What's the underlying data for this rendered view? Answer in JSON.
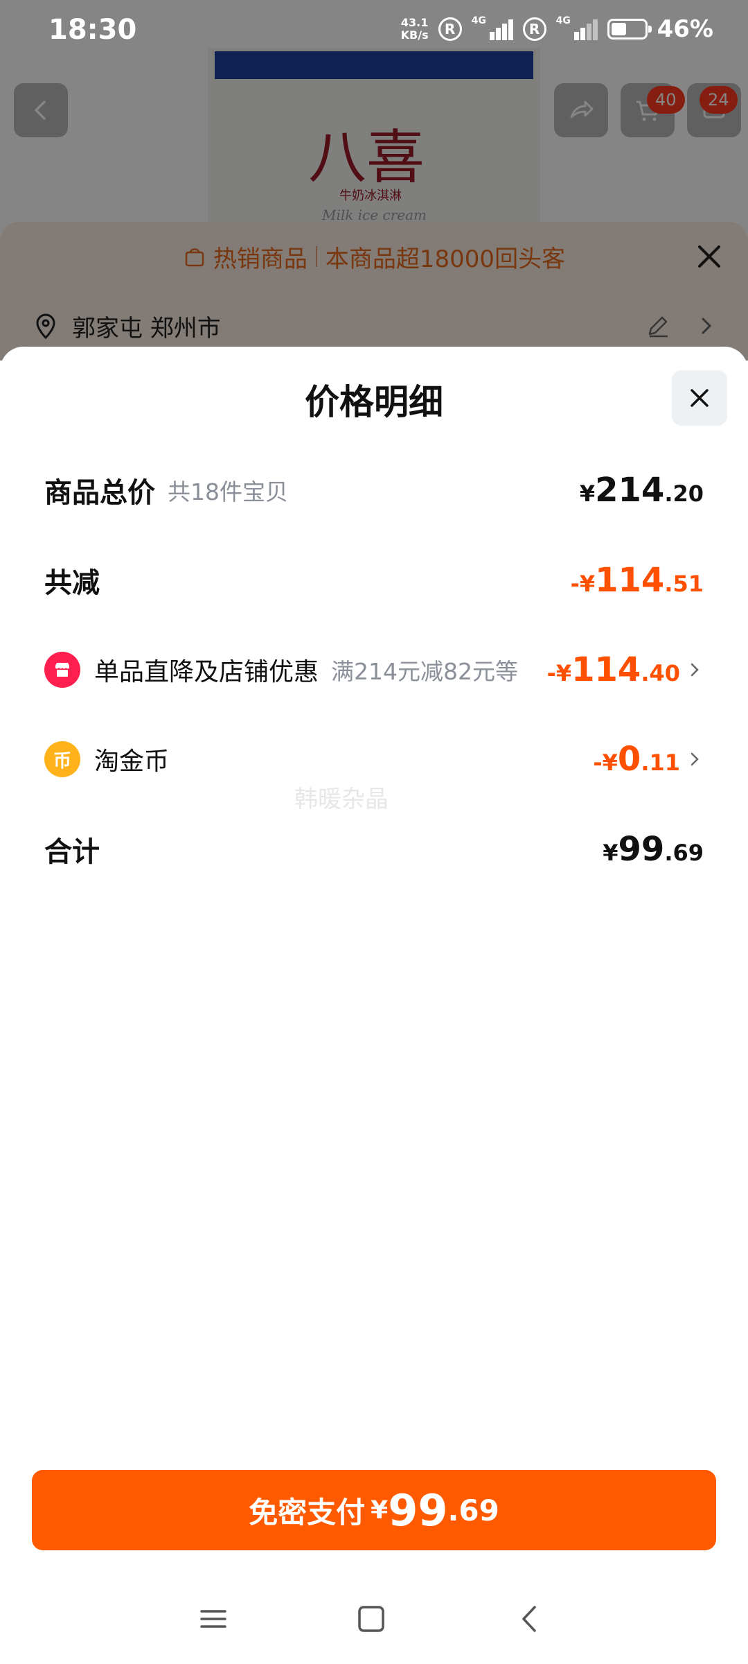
{
  "status_bar": {
    "time": "18:30",
    "net_speed_value": "43.1",
    "net_speed_unit": "KB/s",
    "sim1_label": "4G",
    "sim2_label": "4G",
    "battery_percent": "46%",
    "battery_level": 0.46
  },
  "background": {
    "brand_logo": "八喜",
    "brand_sub": "牛奶冰淇淋",
    "brand_en": "Milk ice cream",
    "cart_badge": "40",
    "msg_badge": "24",
    "hot_tag": "热销商品",
    "hot_text": "本商品超18000回头客",
    "address": "郭家屯 郑州市"
  },
  "sheet": {
    "title": "价格明细",
    "rows": {
      "total": {
        "label": "商品总价",
        "sub": "共18件宝贝",
        "currency": "¥",
        "amount_int": "214",
        "amount_dec": ".20"
      },
      "reduce": {
        "label": "共减",
        "prefix": "-¥",
        "amount_int": "114",
        "amount_dec": ".51"
      },
      "shop_discount": {
        "label": "单品直降及店铺优惠",
        "sub": "满214元减82元等",
        "prefix": "-¥",
        "amount_int": "114",
        "amount_dec": ".40",
        "icon_color": "#ff1f4f"
      },
      "coins": {
        "label": "淘金币",
        "icon_glyph": "币",
        "prefix": "-¥",
        "amount_int": "0",
        "amount_dec": ".11",
        "icon_color": "#ffb21a"
      },
      "sum": {
        "label": "合计",
        "currency": "¥",
        "amount_int": "99",
        "amount_dec": ".69"
      }
    },
    "watermark": "韩暖杂晶"
  },
  "pay_button": {
    "label": "免密支付",
    "currency": "¥",
    "amount_int": "99",
    "amount_dec": ".69",
    "color": "#ff5a00"
  },
  "colors": {
    "accent_orange": "#ff5000",
    "hot_text": "#e86a1f"
  }
}
